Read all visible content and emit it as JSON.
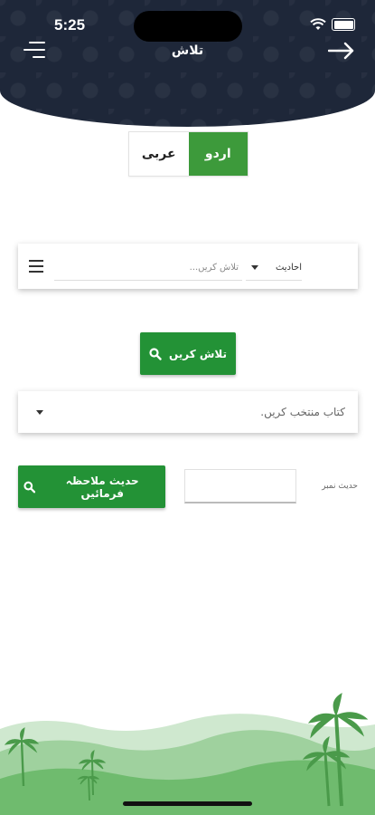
{
  "status_bar": {
    "time": "5:25"
  },
  "header": {
    "title": "تلاش"
  },
  "language_toggle": {
    "options": [
      "اردو",
      "عربی"
    ],
    "selected": "اردو"
  },
  "search": {
    "category_value": "احادیث",
    "input_placeholder": "تلاش کریں..."
  },
  "search_button": {
    "label": "تلاش کریں"
  },
  "book_select": {
    "placeholder": "کتاب منتخب کریں."
  },
  "hadith": {
    "number_label": "حدیث نمبر",
    "button_label": "حدیث ملاحظہ فرمائیں",
    "input_value": ""
  },
  "colors": {
    "header_bg": "#1e2739",
    "primary_green": "#239236",
    "toggle_green": "#3d9a3b"
  }
}
